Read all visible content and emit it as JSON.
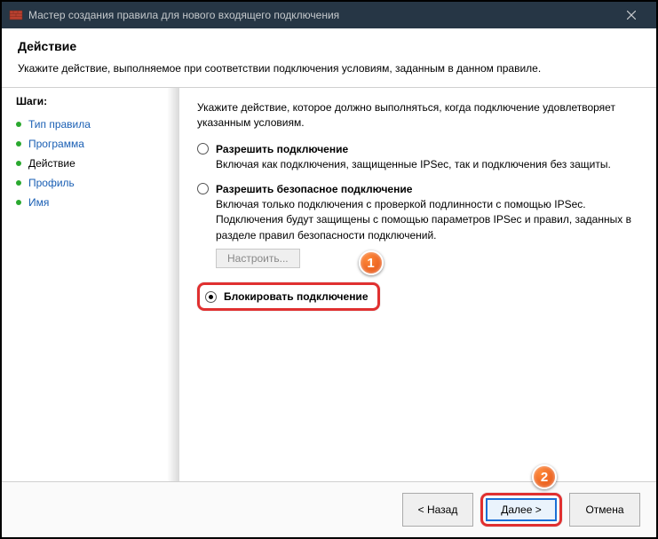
{
  "window": {
    "title": "Мастер создания правила для нового входящего подключения"
  },
  "header": {
    "title": "Действие",
    "description": "Укажите действие, выполняемое при соответствии подключения условиям, заданным в данном правиле."
  },
  "sidebar": {
    "steps_label": "Шаги:",
    "steps": [
      {
        "label": "Тип правила",
        "current": false
      },
      {
        "label": "Программа",
        "current": false
      },
      {
        "label": "Действие",
        "current": true
      },
      {
        "label": "Профиль",
        "current": false
      },
      {
        "label": "Имя",
        "current": false
      }
    ]
  },
  "main": {
    "intro": "Укажите действие, которое должно выполняться, когда подключение удовлетворяет указанным условиям.",
    "options": {
      "allow": {
        "label": "Разрешить подключение",
        "desc": "Включая как подключения, защищенные IPSec, так и подключения без защиты."
      },
      "allow_secure": {
        "label": "Разрешить безопасное подключение",
        "desc": "Включая только подключения с проверкой подлинности с помощью IPSec. Подключения будут защищены с помощью параметров IPSec и правил, заданных в разделе правил безопасности подключений.",
        "customize": "Настроить..."
      },
      "block": {
        "label": "Блокировать подключение"
      }
    }
  },
  "footer": {
    "back": "< Назад",
    "next": "Далее >",
    "cancel": "Отмена"
  },
  "callouts": {
    "one": "1",
    "two": "2"
  }
}
